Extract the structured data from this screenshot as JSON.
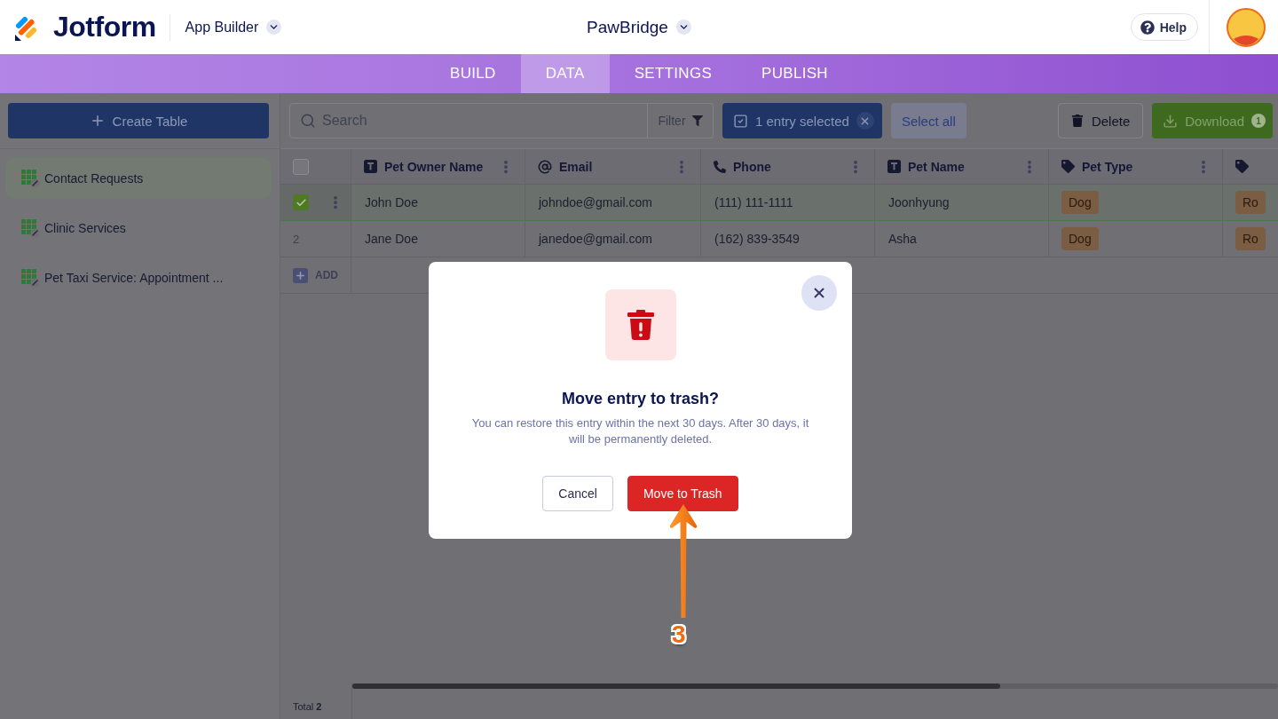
{
  "header": {
    "logo": "Jotform",
    "product": "App Builder",
    "app_name": "PawBridge",
    "help": "Help"
  },
  "nav_tabs": [
    {
      "label": "BUILD",
      "selected": false
    },
    {
      "label": "DATA",
      "selected": true
    },
    {
      "label": "SETTINGS",
      "selected": false
    },
    {
      "label": "PUBLISH",
      "selected": false
    }
  ],
  "sidebar": {
    "create_button": "Create Table",
    "items": [
      {
        "label": "Contact Requests",
        "selected": true
      },
      {
        "label": "Clinic Services",
        "selected": false
      },
      {
        "label": "Pet Taxi Service: Appointment ...",
        "selected": false
      }
    ]
  },
  "toolbar": {
    "search": {
      "placeholder": "Search"
    },
    "filter": "Filter",
    "selection": "1 entry selected",
    "select_all": "Select all",
    "delete": "Delete",
    "download": "Download",
    "download_count": "1"
  },
  "table": {
    "all_selected": false,
    "columns": [
      {
        "label": "Pet Owner Name",
        "kind": "text"
      },
      {
        "label": "Email",
        "kind": "email"
      },
      {
        "label": "Phone",
        "kind": "phone"
      },
      {
        "label": "Pet Name",
        "kind": "text"
      },
      {
        "label": "Pet Type",
        "kind": "tag"
      },
      {
        "kind": "tag"
      }
    ],
    "rows": [
      {
        "selected": true,
        "cells": [
          "John Doe",
          "johndoe@gmail.com",
          "(111) 111-1111",
          "Joonhyung",
          "Dog",
          "Ro"
        ]
      },
      {
        "number": "2",
        "selected": false,
        "cells": [
          "Jane Doe",
          "janedoe@gmail.com",
          "(162) 839-3549",
          "Asha",
          "Dog",
          "Ro"
        ]
      }
    ],
    "add_row": "ADD"
  },
  "footer": {
    "total": "Total **2**"
  },
  "dialog": {
    "title": "Move entry to trash?",
    "message": "You can restore this entry within the next 30 days. After 30 days, it will be permanently deleted.",
    "buttons": [
      {
        "label": "Cancel",
        "kind": "secondary"
      },
      {
        "label": "Move to Trash",
        "kind": "danger"
      }
    ]
  },
  "annotation": {
    "step": "3"
  }
}
